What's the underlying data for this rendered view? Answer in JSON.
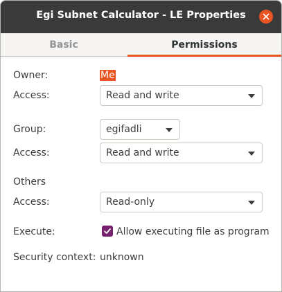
{
  "window": {
    "title": "Egi Subnet Calculator - LE Properties"
  },
  "tabs": [
    {
      "label": "Basic",
      "active": false
    },
    {
      "label": "Permissions",
      "active": true
    }
  ],
  "permissions": {
    "owner_label": "Owner:",
    "owner_value": "Me",
    "owner_access_label": "Access:",
    "owner_access_value": "Read and write",
    "group_label": "Group:",
    "group_value": "egifadli",
    "group_access_label": "Access:",
    "group_access_value": "Read and write",
    "others_heading": "Others",
    "others_access_label": "Access:",
    "others_access_value": "Read-only",
    "execute_label": "Execute:",
    "execute_checkbox_label": "Allow executing file as program",
    "execute_checked": true,
    "security_label": "Security context:",
    "security_value": "unknown"
  },
  "colors": {
    "accent": "#e95420",
    "titlebar": "#3a3a3a",
    "checkbox": "#77216f"
  },
  "icons": {
    "close": "close-icon",
    "dropdown": "chevron-down-icon",
    "check": "check-icon"
  }
}
